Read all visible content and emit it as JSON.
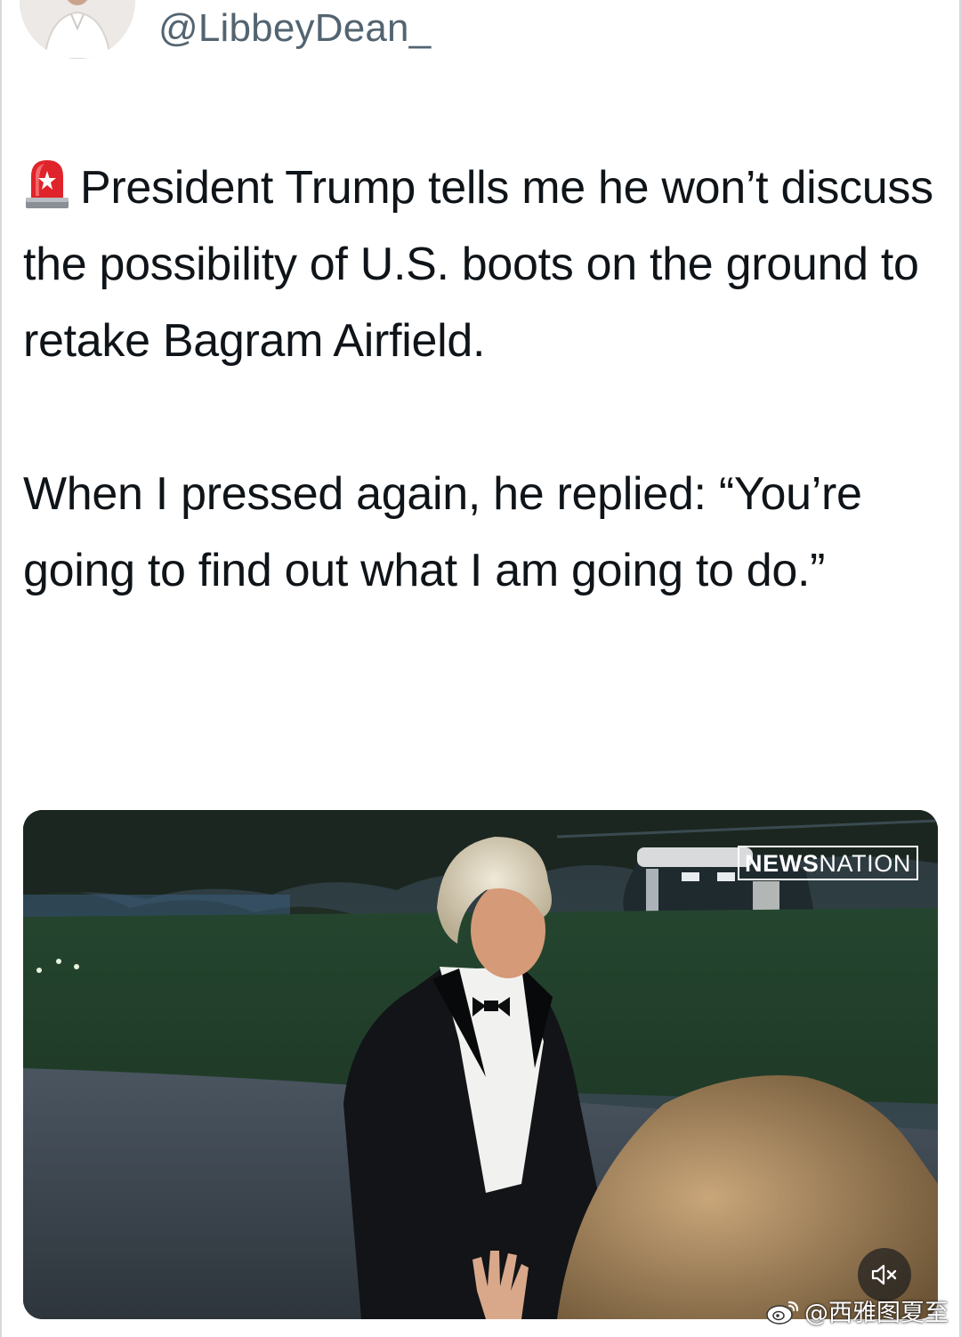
{
  "author": {
    "handle": "@LibbeyDean_"
  },
  "tweet": {
    "paragraph_1": "President Trump tells me he won’t discuss the possibility of U.S. boots on the ground to retake Bagram Airfield.",
    "paragraph_2": "When I pressed again, he replied: “You’re going to find out what I am going to do.”",
    "leading_emoji": "police-car-light-icon"
  },
  "media": {
    "channel_logo_bold": "NEWS",
    "channel_logo_regular": "NATION",
    "mute_icon": "speaker-muted-icon"
  },
  "watermark": {
    "text": "@西雅图夏至",
    "icon": "weibo-icon"
  },
  "colors": {
    "text": "#0f1419",
    "handle": "#536471",
    "siren_red": "#e0242b"
  }
}
